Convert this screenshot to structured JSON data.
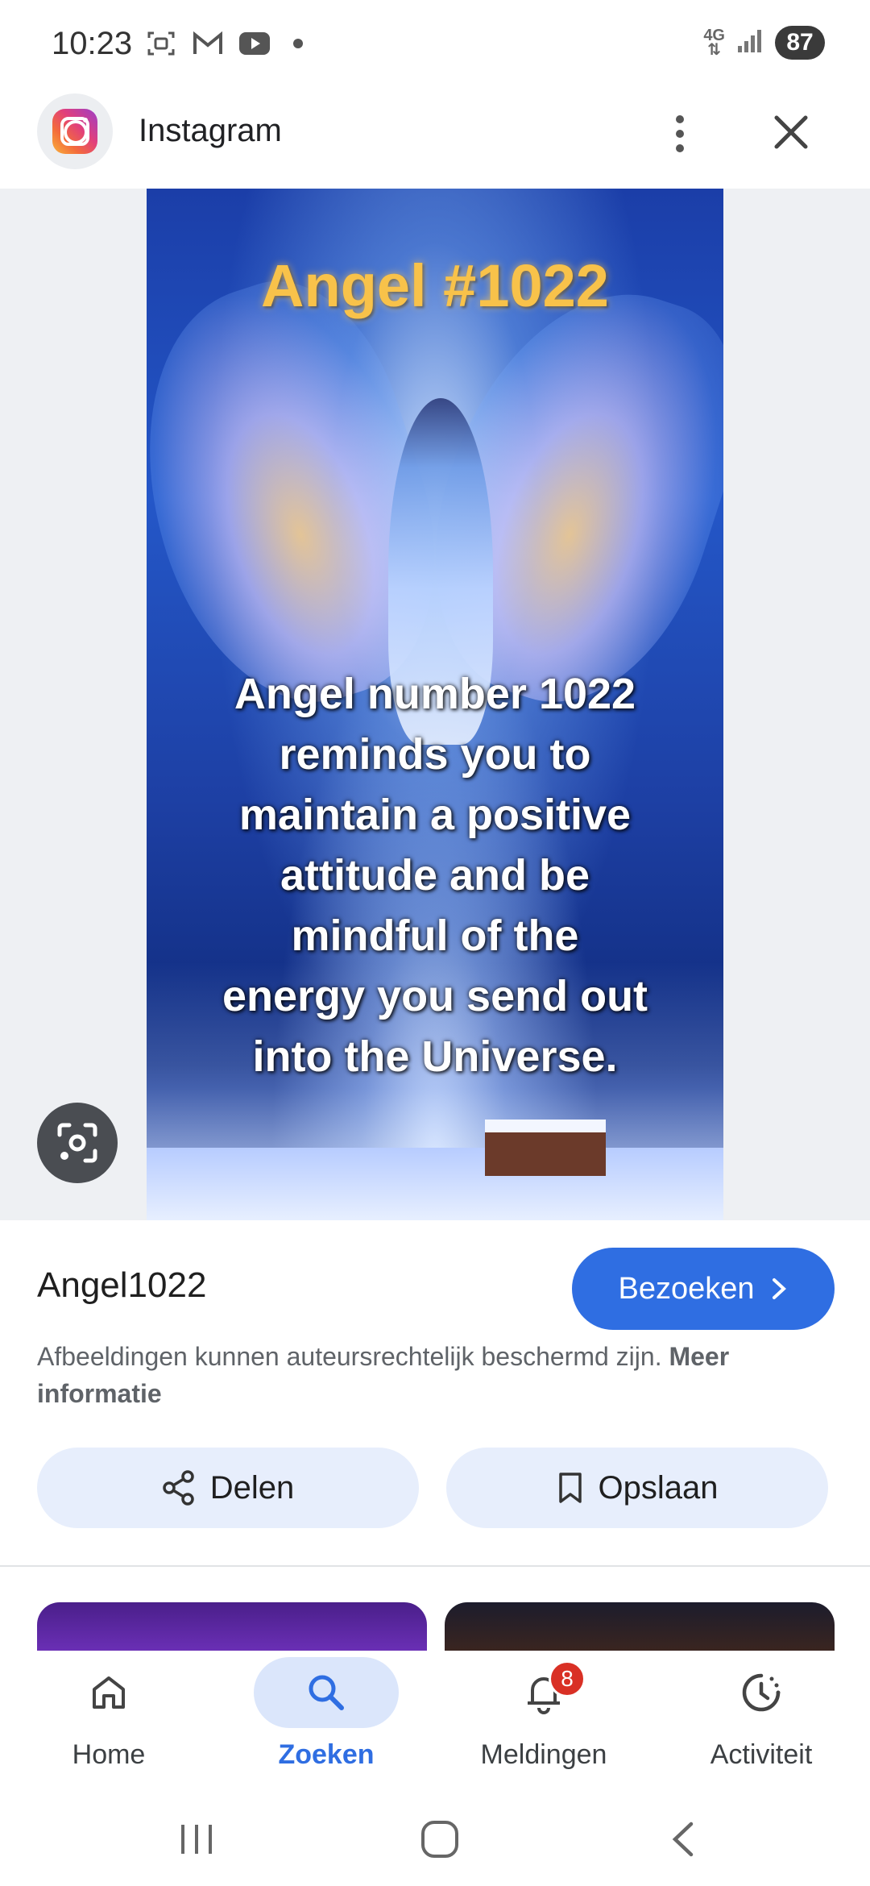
{
  "status_bar": {
    "time": "10:23",
    "network": "4G",
    "battery": "87",
    "icons": [
      "screenshot-icon",
      "gmail-icon",
      "youtube-icon",
      "notification-dot"
    ]
  },
  "header": {
    "app_name": "Instagram",
    "icon": "instagram-icon"
  },
  "image": {
    "title_text": "Angel #1022",
    "body_text": "Angel number 1022\nreminds you to\nmaintain a positive\nattitude and be\nmindful of the\nenergy you send out\ninto the Universe."
  },
  "result": {
    "title": "Angel1022",
    "visit_label": "Bezoeken",
    "copyright_text": "Afbeeldingen kunnen auteursrechtelijk beschermd zijn.",
    "more_info_label": "Meer informatie"
  },
  "actions": {
    "share_label": "Delen",
    "save_label": "Opslaan"
  },
  "bottom_nav": {
    "items": [
      {
        "label": "Home",
        "icon": "home-icon"
      },
      {
        "label": "Zoeken",
        "icon": "search-icon"
      },
      {
        "label": "Meldingen",
        "icon": "bell-icon",
        "badge": "8"
      },
      {
        "label": "Activiteit",
        "icon": "activity-icon"
      }
    ],
    "active": "Zoeken"
  },
  "colors": {
    "accent": "#2f6ee2",
    "badge": "#d93025",
    "action_bg": "#e7eefc"
  }
}
